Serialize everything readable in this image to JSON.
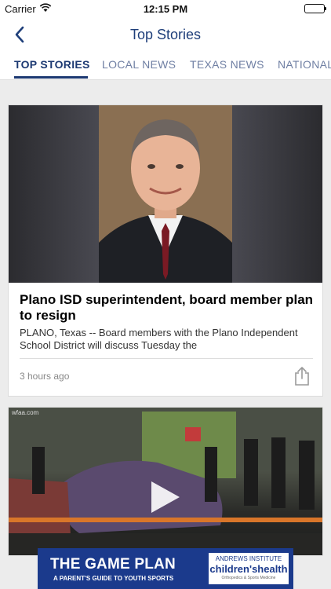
{
  "status_bar": {
    "carrier": "Carrier",
    "time": "12:15 PM"
  },
  "nav": {
    "title": "Top Stories",
    "back_icon": "chevron-left-icon"
  },
  "tabs": [
    {
      "label": "TOP STORIES",
      "active": true
    },
    {
      "label": "LOCAL NEWS",
      "active": false
    },
    {
      "label": "TEXAS NEWS",
      "active": false
    },
    {
      "label": "NATIONAL",
      "active": false
    }
  ],
  "stories": [
    {
      "headline": "Plano ISD superintendent, board member plan to resign",
      "summary": "PLANO, Texas -- Board members with the Plano Independent School District will discuss Tuesday the",
      "timestamp": "3 hours ago",
      "share_icon": "share-icon"
    },
    {
      "source_watermark": "wfaa.com",
      "play_icon": "play-icon"
    }
  ],
  "ad": {
    "title": "THE GAME PLAN",
    "subtitle": "A PARENT'S GUIDE TO YOUTH SPORTS",
    "logo_top": "ANDREWS INSTITUTE",
    "logo_main": "children'shealth",
    "logo_sub": "Orthopedics & Sports Medicine"
  },
  "colors": {
    "accent": "#1c3972",
    "tab_inactive": "#6f7fa3",
    "ad_bg": "#1b3a8c"
  }
}
